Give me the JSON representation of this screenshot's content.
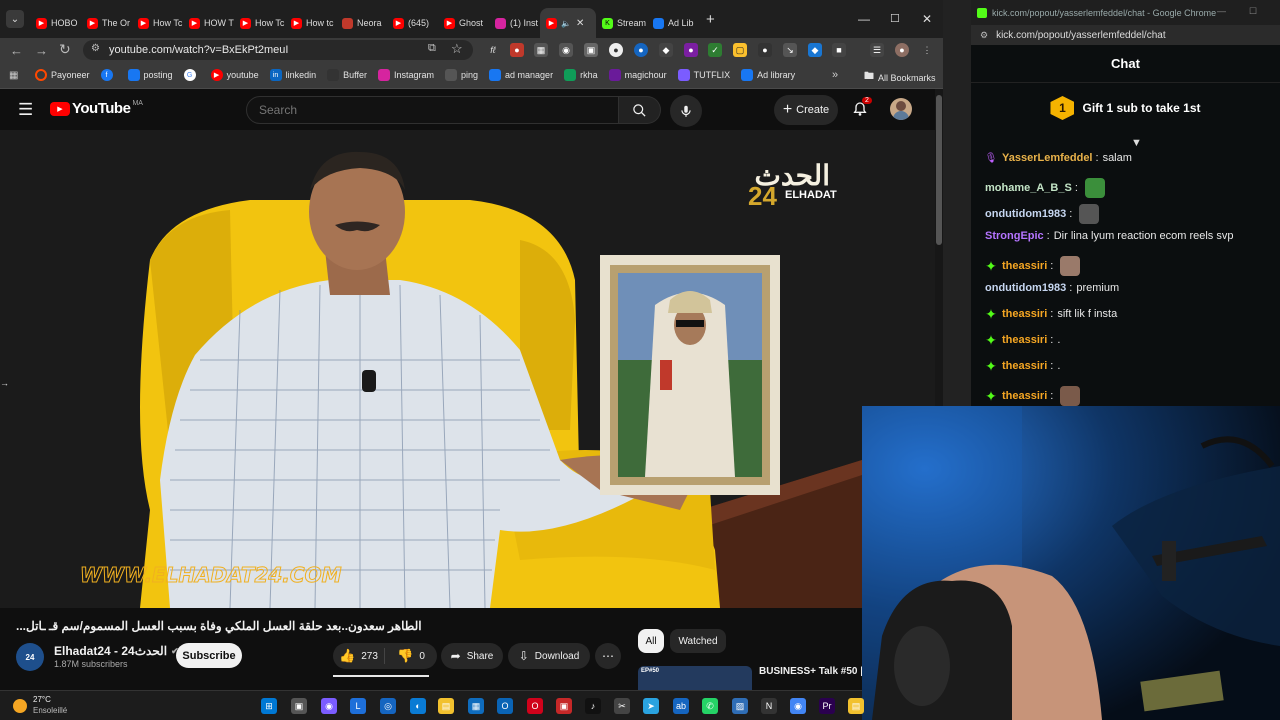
{
  "browser": {
    "tabs": [
      {
        "label": "HOBO",
        "icon": "youtube-icon"
      },
      {
        "label": "The Or",
        "icon": "youtube-icon"
      },
      {
        "label": "How Tc",
        "icon": "youtube-icon"
      },
      {
        "label": "HOW T",
        "icon": "youtube-icon"
      },
      {
        "label": "How Tc",
        "icon": "youtube-icon"
      },
      {
        "label": "How tc",
        "icon": "youtube-icon"
      },
      {
        "label": "Neora",
        "icon": "neora-icon"
      },
      {
        "label": "(645)",
        "icon": "youtube-icon"
      },
      {
        "label": "Ghost",
        "icon": "youtube-icon"
      },
      {
        "label": "(1) Inst",
        "icon": "instagram-icon"
      },
      {
        "label": "",
        "icon": "youtube-icon",
        "active": true
      },
      {
        "label": "Stream",
        "icon": "kick-icon"
      },
      {
        "label": "Ad Lib",
        "icon": "meta-icon"
      }
    ],
    "new_tab": "+",
    "url": "youtube.com/watch?v=BxEkPt2meuI",
    "bookmarks": [
      {
        "label": "Payoneer",
        "icon": "payoneer-icon"
      },
      {
        "label": "",
        "icon": "facebook-icon"
      },
      {
        "label": "posting",
        "icon": "meta-icon"
      },
      {
        "label": "",
        "icon": "google-icon"
      },
      {
        "label": "youtube",
        "icon": "youtube-icon"
      },
      {
        "label": "linkedin",
        "icon": "linkedin-icon"
      },
      {
        "label": "Buffer",
        "icon": "buffer-icon"
      },
      {
        "label": "Instagram",
        "icon": "instagram-icon"
      },
      {
        "label": "ping",
        "icon": "ping-icon"
      },
      {
        "label": "ad manager",
        "icon": "meta-icon"
      },
      {
        "label": "rkha",
        "icon": "sheets-icon"
      },
      {
        "label": "magichour",
        "icon": "magichour-icon"
      },
      {
        "label": "TUTFLIX",
        "icon": "tutflix-icon"
      },
      {
        "label": "Ad library",
        "icon": "meta-icon"
      }
    ],
    "more_bookmarks": "»",
    "all_bookmarks": "All Bookmarks"
  },
  "youtube": {
    "logo_text": "YouTube",
    "region": "MA",
    "search_placeholder": "Search",
    "create_label": "Create",
    "notif_count": "2",
    "video_watermark_top": "الحدث",
    "video_watermark_num": "24",
    "video_watermark_sub": "ELHADAT",
    "video_watermark_url": "WWW.ELHADAT24.COM",
    "title": "...الطاهر سعدون..بعد حلقة العسل الملكي وفاة بسبب العسل المسموم/سم قـ ـاتل",
    "channel_name": "Elhadat24 - الحدث24",
    "subscribers": "1.87M subscribers",
    "subscribe_label": "Subscribe",
    "likes": "273",
    "dislikes": "0",
    "share_label": "Share",
    "download_label": "Download",
    "more_label": "⋯",
    "filter_all": "All",
    "filter_watched": "Watched",
    "suggested_title": "BUSINESS+ Talk #50 |",
    "suggested_tag": "EP#50"
  },
  "kick": {
    "window_title": "kick.com/popout/yasserlemfeddel/chat - Google Chrome",
    "url": "kick.com/popout/yasserlemfeddel/chat",
    "chat_title": "Chat",
    "gift_label": "Gift 1 sub to take 1st",
    "gift_count": "1",
    "messages": [
      {
        "user": "YasserLemfeddel",
        "text": "salam",
        "color": "#e9b24a",
        "badge": "mic-icon"
      },
      {
        "user": "mohame_A_B_S",
        "text": "",
        "color": "#c3e4c6",
        "badge": "",
        "emote": true
      },
      {
        "user": "ondutidom1983",
        "text": "",
        "color": "#c6d6f0",
        "badge": "",
        "emote": true
      },
      {
        "user": "StrongEpic",
        "text": "Dir lina lyum reaction ecom reels svp",
        "color": "#b574ff",
        "badge": ""
      },
      {
        "user": "theassiri",
        "text": "",
        "color": "#f5a623",
        "badge": "sparkle-icon",
        "emote": true
      },
      {
        "user": "ondutidom1983",
        "text": "premium",
        "color": "#c6d6f0",
        "badge": ""
      },
      {
        "user": "theassiri",
        "text": "sift lik f insta",
        "color": "#f5a623",
        "badge": "sparkle-icon"
      },
      {
        "user": "theassiri",
        "text": ".",
        "color": "#f5a623",
        "badge": "sparkle-icon"
      },
      {
        "user": "theassiri",
        "text": ".",
        "color": "#f5a623",
        "badge": "sparkle-icon"
      },
      {
        "user": "theassiri",
        "text": "",
        "color": "#f5a623",
        "badge": "sparkle-icon",
        "emote": true
      }
    ]
  },
  "taskbar": {
    "temperature": "27°C",
    "weather": "Ensoleillé"
  }
}
